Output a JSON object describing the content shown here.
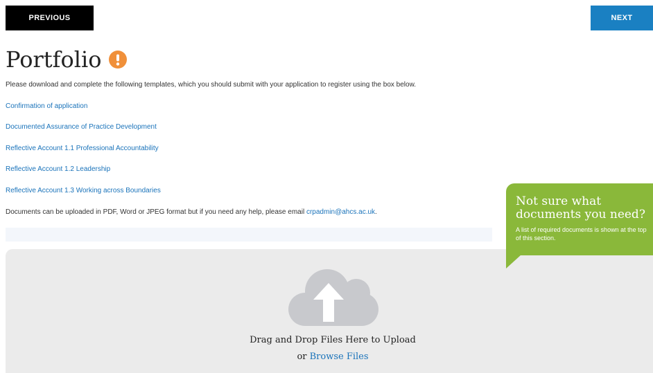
{
  "nav": {
    "previous_label": "PREVIOUS",
    "next_label": "NEXT"
  },
  "page": {
    "title": "Portfolio",
    "intro": "Please download and complete the following templates, which you should submit with your application to register using the box below."
  },
  "documents": [
    {
      "label": "Confirmation of application"
    },
    {
      "label": "Documented Assurance of Practice Development"
    },
    {
      "label": "Reflective Account 1.1 Professional Accountability"
    },
    {
      "label": "Reflective Account 1.2 Leadership"
    },
    {
      "label": "Reflective Account 1.3 Working across Boundaries"
    }
  ],
  "formats_note": {
    "text": "Documents can be uploaded in PDF, Word or JPEG format but if you need any help, please email ",
    "email": "crpadmin@ahcs.ac.uk",
    "suffix": "."
  },
  "upload": {
    "drag_text": "Drag and Drop Files Here to Upload",
    "or_text": "or ",
    "browse_label": "Browse Files"
  },
  "help": {
    "title": "Not sure what documents you need?",
    "subtitle": "A list of required documents is shown at the top of this section."
  },
  "icons": {
    "warning": "exclamation-circle-icon",
    "upload": "cloud-upload-icon"
  },
  "colors": {
    "accent": "#1a80c2",
    "link": "#1a73ba",
    "warning": "#f0903a",
    "callout": "#8ab83a",
    "dropzone": "#ebebeb",
    "cloud": "#c8c9cd"
  }
}
